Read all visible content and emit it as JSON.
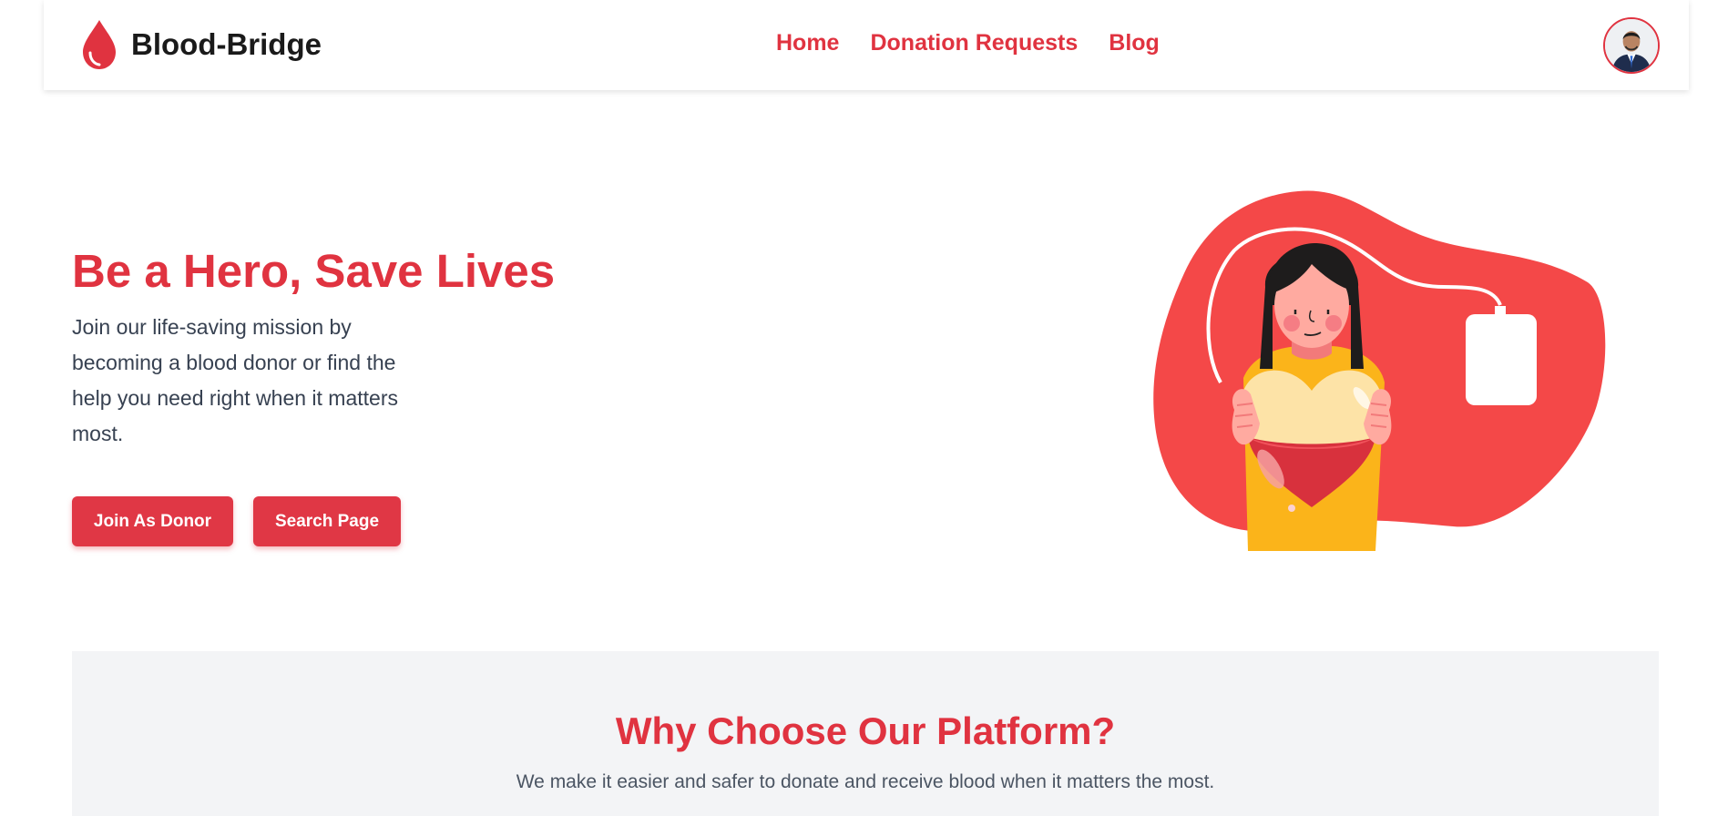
{
  "brand": {
    "name": "Blood-Bridge",
    "icon": "blood-drop-icon",
    "color": "#e03340"
  },
  "nav": {
    "links": [
      {
        "label": "Home"
      },
      {
        "label": "Donation Requests"
      },
      {
        "label": "Blog"
      }
    ],
    "avatar": "user-avatar"
  },
  "hero": {
    "title": "Be a Hero, Save Lives",
    "text": "Join our life-saving mission by becoming a blood donor or find the help you need right when it matters most.",
    "buttons": {
      "join_donor": "Join As Donor",
      "search_page": "Search Page"
    },
    "illustration": "woman-holding-heart-blood-bag-illustration"
  },
  "why": {
    "title": "Why Choose Our Platform?",
    "subtitle": "We make it easier and safer to donate and receive blood when it matters the most."
  },
  "colors": {
    "accent": "#e03340",
    "button": "#e03745",
    "section_bg": "#f3f4f6",
    "blob": "#f44848"
  }
}
